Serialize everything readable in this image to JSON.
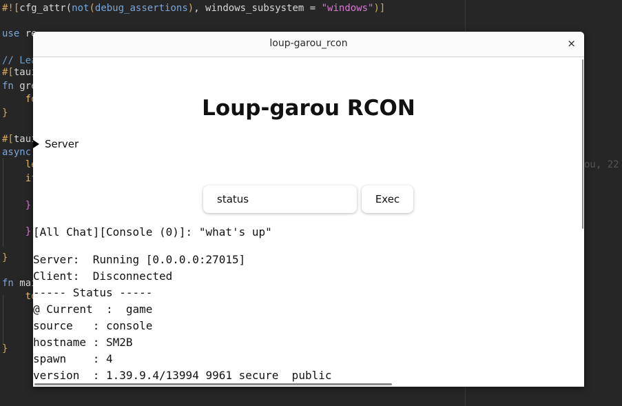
{
  "editor": {
    "lines": [
      {
        "parts": [
          [
            "pun",
            "#!["
          ],
          [
            "",
            "cfg_attr("
          ],
          [
            "kw",
            "not"
          ],
          [
            "pun",
            "("
          ],
          [
            "kw",
            "debug_assertions"
          ],
          [
            "pun",
            ")"
          ],
          [
            "",
            ", windows_subsystem = "
          ],
          [
            "str",
            "\"windows\""
          ],
          [
            "pun",
            ")]"
          ]
        ]
      },
      {
        "parts": [
          [
            "kw",
            "use"
          ],
          [
            "",
            " re"
          ]
        ]
      },
      {
        "parts": [
          [
            "cm",
            "// Lea"
          ]
        ]
      },
      {
        "parts": [
          [
            "pun",
            "#["
          ],
          [
            "",
            "taui"
          ]
        ]
      },
      {
        "parts": [
          [
            "kw",
            "fn"
          ],
          [
            "",
            " gre"
          ]
        ]
      },
      {
        "parts": [
          [
            "",
            ""
          ],
          [
            "dim",
            "    fo"
          ]
        ]
      },
      {
        "parts": [
          [
            "pun",
            "}"
          ]
        ]
      },
      {
        "parts": [
          [
            "pun",
            "#["
          ],
          [
            "",
            "taui"
          ]
        ]
      },
      {
        "parts": [
          [
            "kw",
            "async"
          ]
        ]
      },
      {
        "parts": [
          [
            "dim",
            "    le"
          ]
        ]
      },
      {
        "parts": [
          [
            "dim",
            "    if"
          ]
        ]
      },
      {
        "parts": [
          [
            "str",
            "    }"
          ]
        ]
      },
      {
        "parts": [
          [
            "str",
            "    }"
          ]
        ]
      },
      {
        "parts": [
          [
            "pun",
            "}"
          ]
        ]
      },
      {
        "parts": [
          [
            "kw",
            "fn"
          ],
          [
            "",
            " mai"
          ]
        ]
      },
      {
        "parts": [
          [
            "dim",
            "    to"
          ]
        ]
      },
      {
        "parts": [
          [
            "pun",
            "}"
          ]
        ]
      }
    ],
    "ghost": "ou, 22"
  },
  "window": {
    "title": "loup-garou_rcon",
    "close_glyph": "×"
  },
  "app": {
    "heading": "Loup-garou RCON",
    "details_label": "Server",
    "command_value": "status",
    "exec_label": "Exec",
    "chat_line": "[All Chat][Console (0)]: \"what's up\"",
    "output": [
      "Server:  Running [0.0.0.0:27015]",
      "Client:  Disconnected",
      "----- Status -----",
      "@ Current  :  game",
      "source   : console",
      "hostname : SM2B",
      "spawn    : 4",
      "version  : 1.39.9.4/13994 9961 secure  public"
    ]
  }
}
